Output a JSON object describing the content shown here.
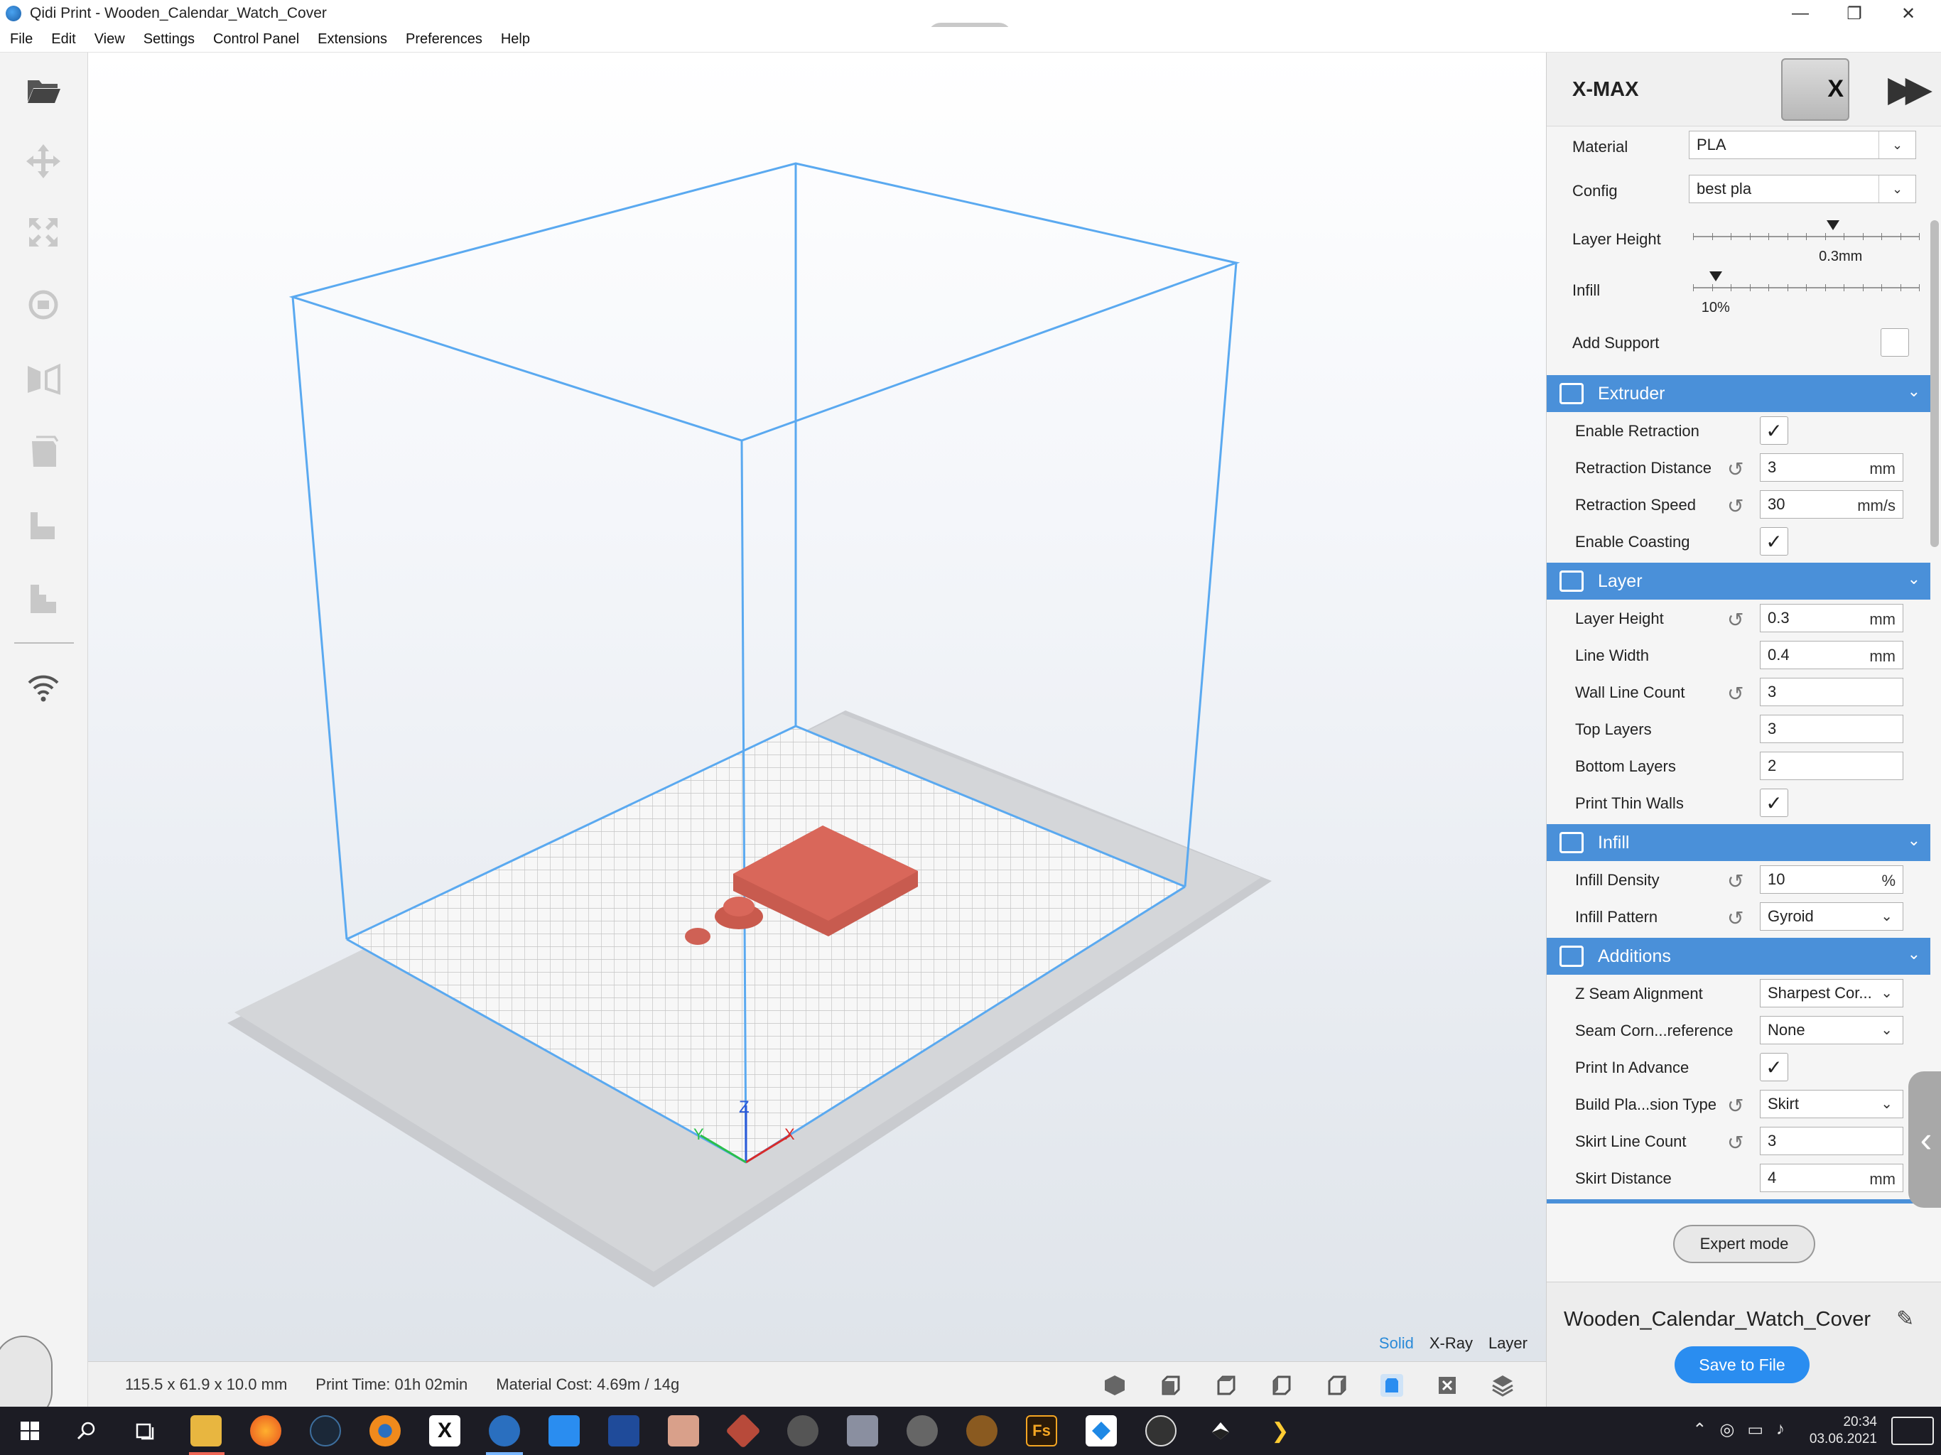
{
  "window": {
    "title": "Qidi Print - Wooden_Calendar_Watch_Cover",
    "minimize": "—",
    "restore": "❐",
    "close": "✕"
  },
  "menu": [
    "File",
    "Edit",
    "View",
    "Settings",
    "Control Panel",
    "Extensions",
    "Preferences",
    "Help"
  ],
  "left_toolbar": {
    "tools": [
      "open-folder-icon",
      "move-icon",
      "scale-icon",
      "rotate-icon",
      "mirror-icon",
      "support-blocker-icon",
      "per-model-settings-icon",
      "lay-flat-icon",
      "wifi-icon"
    ]
  },
  "viewport": {
    "view_modes": [
      "Solid",
      "X-Ray",
      "Layer"
    ],
    "active_view_mode": "Solid",
    "axes": {
      "x": "X",
      "y": "Y",
      "z": "Z"
    }
  },
  "status": {
    "dimensions": "115.5 x 61.9 x 10.0 mm",
    "print_time": "Print Time: 01h 02min",
    "material_cost": "Material Cost: 4.69m / 14g"
  },
  "view_icons": [
    "3d-view-icon",
    "front-view-icon",
    "top-view-icon",
    "left-view-icon",
    "right-view-icon",
    "model-view-icon",
    "close-view-icon",
    "layers-icon"
  ],
  "right_panel": {
    "machine": "X-MAX",
    "material": {
      "label": "Material",
      "value": "PLA"
    },
    "config": {
      "label": "Config",
      "value": "best pla"
    },
    "layer_height_slider": {
      "label": "Layer Height",
      "value_text": "0.3mm",
      "position": 0.62
    },
    "infill_slider": {
      "label": "Infill",
      "value_text": "10%",
      "position": 0.1
    },
    "add_support": {
      "label": "Add Support",
      "checked": false
    },
    "sections": {
      "extruder": {
        "title": "Extruder",
        "settings": [
          {
            "label": "Enable Retraction",
            "type": "check",
            "checked": true
          },
          {
            "label": "Retraction Distance",
            "value": "3",
            "unit": "mm",
            "reset": true
          },
          {
            "label": "Retraction Speed",
            "value": "30",
            "unit": "mm/s",
            "reset": true
          },
          {
            "label": "Enable Coasting",
            "type": "check",
            "checked": true
          }
        ]
      },
      "layer": {
        "title": "Layer",
        "settings": [
          {
            "label": "Layer Height",
            "value": "0.3",
            "unit": "mm",
            "reset": true
          },
          {
            "label": "Line Width",
            "value": "0.4",
            "unit": "mm"
          },
          {
            "label": "Wall Line Count",
            "value": "3",
            "reset": true
          },
          {
            "label": "Top Layers",
            "value": "3"
          },
          {
            "label": "Bottom Layers",
            "value": "2"
          },
          {
            "label": "Print Thin Walls",
            "type": "check",
            "checked": true
          }
        ]
      },
      "infill": {
        "title": "Infill",
        "settings": [
          {
            "label": "Infill Density",
            "value": "10",
            "unit": "%",
            "reset": true
          },
          {
            "label": "Infill Pattern",
            "value": "Gyroid",
            "type": "select",
            "reset": true
          }
        ]
      },
      "additions": {
        "title": "Additions",
        "settings": [
          {
            "label": "Z Seam Alignment",
            "value": "Sharpest Cor...",
            "type": "select"
          },
          {
            "label": "Seam Corn...reference",
            "value": "None",
            "type": "select"
          },
          {
            "label": "Print In Advance",
            "type": "check",
            "checked": true
          },
          {
            "label": "Build Pla...sion Type",
            "value": "Skirt",
            "type": "select",
            "reset": true
          },
          {
            "label": "Skirt Line Count",
            "value": "3",
            "reset": true
          },
          {
            "label": "Skirt Distance",
            "value": "4",
            "unit": "mm"
          }
        ]
      }
    },
    "expert_mode": "Expert mode",
    "job_name": "Wooden_Calendar_Watch_Cover",
    "save_button": "Save to File"
  },
  "taskbar": {
    "time": "20:34",
    "date": "03.06.2021",
    "apps": [
      "windows-start-icon",
      "search-icon",
      "task-view-icon",
      "file-explorer-icon",
      "firefox-icon",
      "steam-icon",
      "blender-icon",
      "x-app-icon",
      "qidi-print-icon",
      "vscode-icon",
      "powershell-icon",
      "avatar-app-icon",
      "3d-app-icon",
      "m-app-icon",
      "calculator-icon",
      "vr-app-icon",
      "tree-app-icon",
      "fs-app-icon",
      "blue-diamond-app-icon",
      "obs-icon",
      "inkscape-icon",
      "terminal-app-icon"
    ],
    "fs_label": "Fs"
  },
  "colors": {
    "accent": "#4a90d9",
    "save_button": "#2a8df0",
    "model": "#d9675a",
    "build_volume": "#5aa9f0"
  }
}
